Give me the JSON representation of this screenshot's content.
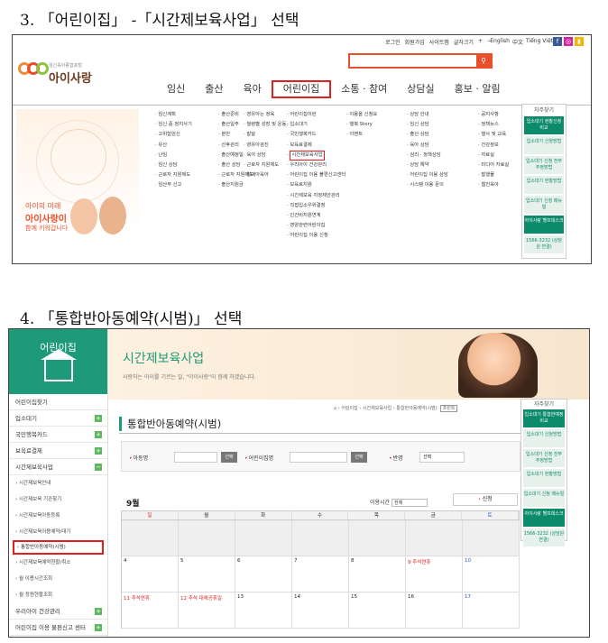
{
  "step3_title": "3. 「어린이집」 -「시간제보육사업」 선택",
  "step4_title": "4. 「통합반아동예약(시범)」 선택",
  "shot1": {
    "util_links": [
      "로그인",
      "회원가입",
      "사이트맵",
      "글자크기",
      "+",
      "−",
      "English",
      "中文",
      "Tiếng Việt"
    ],
    "sns": [
      "f",
      "◎",
      "▮"
    ],
    "search_icon": "magnifier-icon",
    "logo_tagline": "임신육아종합포털",
    "logo_name": "아이사랑",
    "gnb": [
      "임신",
      "출산",
      "육아",
      "어린이집",
      "소통 · 참여",
      "상담실",
      "홍보 · 알림"
    ],
    "banner": {
      "line1": "아이의 미래",
      "line2": "아이사랑이",
      "line3": "함께 키워갑니다"
    },
    "cols": [
      [
        "임신계획",
        "임신 중 정지사기",
        "고위험임신",
        "유산",
        "난임",
        "임신 상담",
        "근로자 지원제도",
        "임산부 신고"
      ],
      [
        "출산준비",
        "출산일주",
        "분만",
        "산후관리",
        "출산예정일",
        "출산 상담",
        "근로자 지원제도",
        "출산지원금"
      ],
      [
        "영유아는 정육",
        "월령별 성장 및 운동",
        "발달",
        "영유아검진",
        "육아 상담",
        "근로자 지원제도",
        "장애아육아"
      ],
      [
        "어린이집이란",
        "입소대기",
        "국민행복카드",
        "보육료결제",
        "시간제보육사업",
        "우리아이 건강관리",
        "어린이집 이용 불편신고센터",
        "보육료지원",
        "시간제보육 지정제안관리",
        "직접입소우위결정",
        "인건비지원연계",
        "영양관련어린이집",
        "어린이집 이용 신청"
      ],
      [
        "이용을 신청요",
        "행복 Story",
        "이벤트"
      ],
      [
        "상담 안내",
        "임신 상담",
        "출산 상담",
        "육아 상담",
        "심리 · 정책상담",
        "상담 예약",
        "어린이집 이용 상담",
        "시스템 이용 문의"
      ],
      [
        "공지사항",
        "정책뉴스",
        "행사 및 교육",
        "건강정보",
        "자료실",
        "미디어 자료실",
        "발행물",
        "웹진육아"
      ]
    ],
    "highlight": "시간제보육사업",
    "quick": {
      "head": "자주찾기",
      "items": [
        "입소대기 현황신청 비교",
        "입소대기 신청방법",
        "입소대기 신청 전부 추정방법",
        "입소대기 현황방법",
        "입소대기 신청 매뉴얼",
        "아이사랑 헬프데스크",
        "1566-3232 (상담원 연결)"
      ]
    }
  },
  "shot2": {
    "left_title": "어린이집",
    "house_icon": "house-icon",
    "menu": [
      {
        "label": "어린이집찾기",
        "type": "it"
      },
      {
        "label": "입소대기",
        "type": "it",
        "pm": "+"
      },
      {
        "label": "국민행복카드",
        "type": "it",
        "pm": "+"
      },
      {
        "label": "보육료결제",
        "type": "it",
        "pm": "+"
      },
      {
        "label": "시간제보육사업",
        "type": "it",
        "pm": "−"
      },
      {
        "label": "› 시간제보육안내",
        "type": "sub"
      },
      {
        "label": "› 시간제보육 기관찾기",
        "type": "sub"
      },
      {
        "label": "› 시간제보육아동등록",
        "type": "sub"
      },
      {
        "label": "› 시간제보육이용예약/대기",
        "type": "sub"
      },
      {
        "label": "› 통합반아동예약(시범)",
        "type": "sub",
        "sel": true
      },
      {
        "label": "› 시간제보육예약현황/취소",
        "type": "sub"
      },
      {
        "label": "› 월 이용시간조회",
        "type": "sub"
      },
      {
        "label": "› 월 정원현황조회",
        "type": "sub"
      },
      {
        "label": "우리아이 건강관리",
        "type": "it",
        "pm": "+"
      },
      {
        "label": "어린이집 이용 불편신고 센터",
        "type": "it",
        "pm": "+"
      }
    ],
    "hero_title": "시간제보육사업",
    "hero_sub": "사랑하는 아이를 기르는 일, \"아이사랑\"이 함께 하겠습니다.",
    "breadcrumb": "⌂ › 어린이집 › 시간제보육사업 › 통합반아동예약(시범)",
    "print": "프린트",
    "page_title": "통합반아동예약(시범)",
    "filter": {
      "child": "아동명",
      "search1": "선택",
      "center": "어린이집명",
      "search2": "선택",
      "class": "반명",
      "class_val": "선택"
    },
    "month": "9월",
    "use_time": {
      "label": "이용시간",
      "value": "전체"
    },
    "apply": "신청",
    "days": [
      "일",
      "월",
      "화",
      "수",
      "목",
      "금",
      "토"
    ],
    "weeks": [
      [
        {
          "n": "",
          "g": 1
        },
        {
          "n": "",
          "g": 1
        },
        {
          "n": "",
          "g": 1
        },
        {
          "n": "",
          "g": 1
        },
        {
          "n": "",
          "g": 1
        },
        {
          "n": "",
          "g": 1
        },
        {
          "n": "",
          "g": 1
        }
      ],
      [
        {
          "n": "4"
        },
        {
          "n": "5"
        },
        {
          "n": "6"
        },
        {
          "n": "7"
        },
        {
          "n": "8"
        },
        {
          "n": "9 추석연휴",
          "c": "red"
        },
        {
          "n": "10",
          "c": "blue"
        }
      ],
      [
        {
          "n": "11 추석연휴",
          "c": "red"
        },
        {
          "n": "12 추석 대체공휴일",
          "c": "red"
        },
        {
          "n": "13"
        },
        {
          "n": "14"
        },
        {
          "n": "15"
        },
        {
          "n": "16"
        },
        {
          "n": "17",
          "c": "blue"
        }
      ]
    ],
    "quick": {
      "head": "자주찾기",
      "items": [
        "입소대기 통합반예정 비교",
        "입소대기 신청방법",
        "입소대기 신청 전부 추정방법",
        "입소대기 현황방법",
        "입소대기 신청 매뉴얼",
        "아이사랑 헬프데스크",
        "1566-3232 (상담원 연결)"
      ]
    }
  }
}
